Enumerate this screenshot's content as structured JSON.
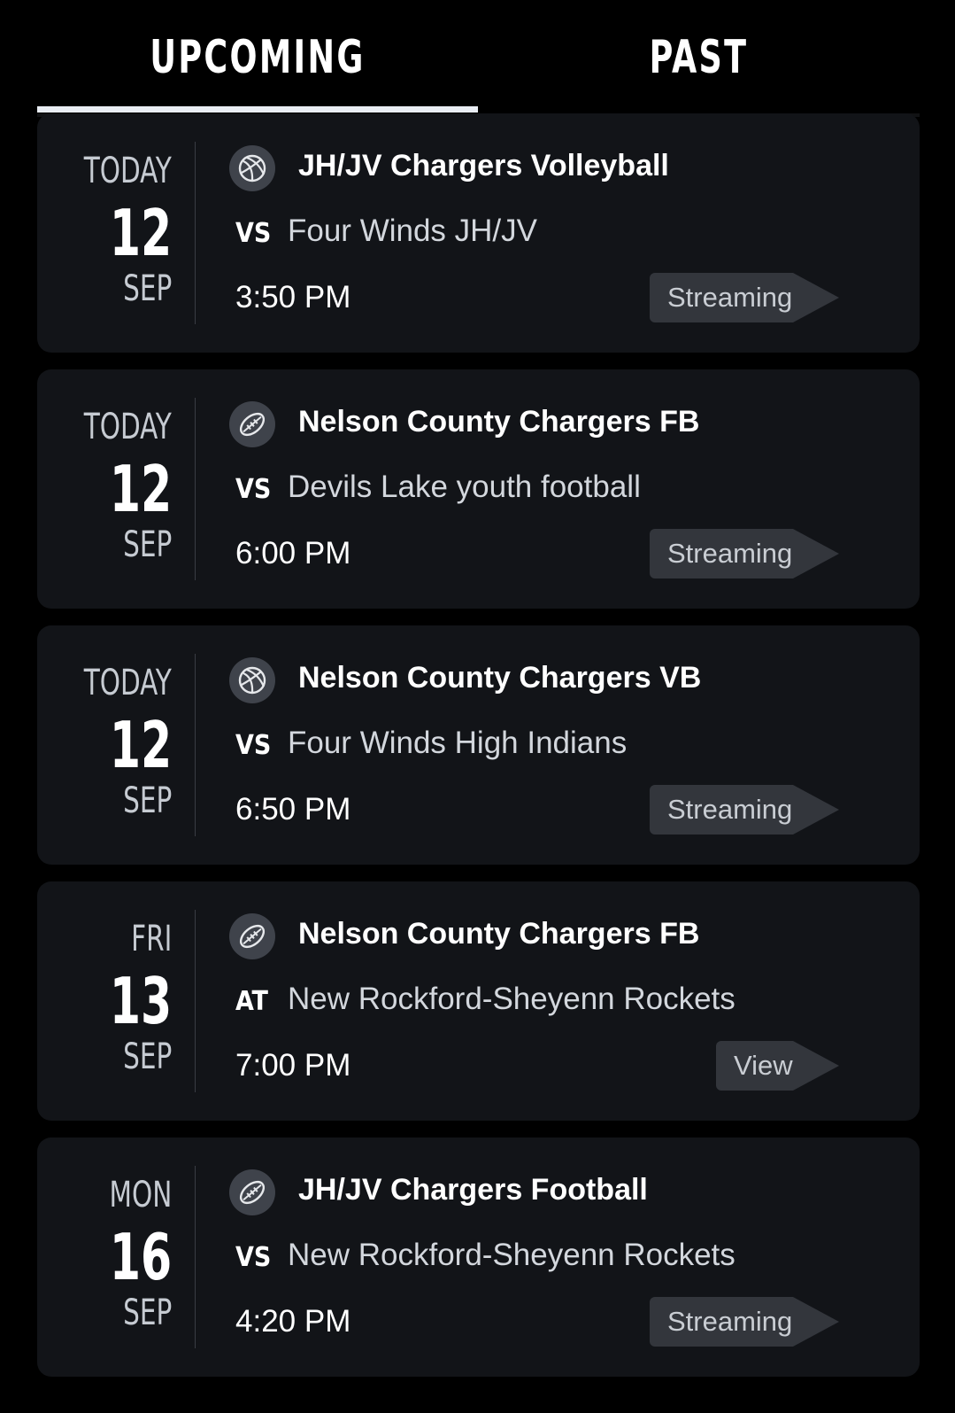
{
  "tabs": [
    {
      "label": "UPCOMING",
      "active": true
    },
    {
      "label": "PAST",
      "active": false
    }
  ],
  "colors": {
    "background": "#000000",
    "card": "#121418",
    "active_underline": "#e9edf4",
    "button": "#33363c"
  },
  "events": [
    {
      "day": "TODAY",
      "date": "12",
      "month": "SEP",
      "sport_icon": "volleyball-icon",
      "team": "JH/JV Chargers Volleyball",
      "vs": "VS",
      "opponent": "Four Winds JH/JV",
      "time": "3:50 PM",
      "action": "Streaming"
    },
    {
      "day": "TODAY",
      "date": "12",
      "month": "SEP",
      "sport_icon": "football-icon",
      "team": "Nelson County Chargers FB",
      "vs": "VS",
      "opponent": "Devils Lake youth football",
      "time": "6:00 PM",
      "action": "Streaming"
    },
    {
      "day": "TODAY",
      "date": "12",
      "month": "SEP",
      "sport_icon": "volleyball-icon",
      "team": "Nelson County Chargers VB",
      "vs": "VS",
      "opponent": "Four Winds High Indians",
      "time": "6:50 PM",
      "action": "Streaming"
    },
    {
      "day": "FRI",
      "date": "13",
      "month": "SEP",
      "sport_icon": "football-icon",
      "team": "Nelson County Chargers FB",
      "vs": "AT",
      "opponent": "New Rockford-Sheyenn Rockets",
      "time": "7:00 PM",
      "action": "View"
    },
    {
      "day": "MON",
      "date": "16",
      "month": "SEP",
      "sport_icon": "football-icon",
      "team": "JH/JV Chargers Football",
      "vs": "VS",
      "opponent": "New Rockford-Sheyenn Rockets",
      "time": "4:20 PM",
      "action": "Streaming"
    }
  ]
}
